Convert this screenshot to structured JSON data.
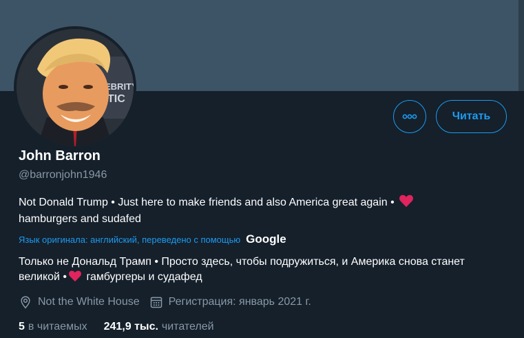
{
  "profile": {
    "name": "John Barron",
    "handle": "@barronjohn1946",
    "bio_part1": "Not Donald Trump • Just here to make friends and also America great again •",
    "bio_part2": "hamburgers and sudafed",
    "translation_note": "Язык оригинала: английский, переведено с помощью",
    "translation_provider": "Google",
    "translated_part1": "Только не Дональд Трамп • Просто здесь, чтобы подружиться, и Америка снова станет великой •",
    "translated_part2": "гамбургеры и судафед",
    "location": "Not the White House",
    "joined": "Регистрация: январь 2021 г.",
    "following_count": "5",
    "following_label": "в читаемых",
    "followers_count": "241,9 тыс.",
    "followers_label": "читателей"
  },
  "actions": {
    "more_icon": "more-horizontal-icon",
    "follow_label": "Читать"
  },
  "icons": {
    "location": "location-pin-icon",
    "calendar": "calendar-icon",
    "heart": "heart-emoji"
  },
  "colors": {
    "background": "#15202b",
    "banner": "#3d5466",
    "accent": "#1d9bf0",
    "secondary_text": "#8899a6",
    "heart": "#e0245e"
  }
}
